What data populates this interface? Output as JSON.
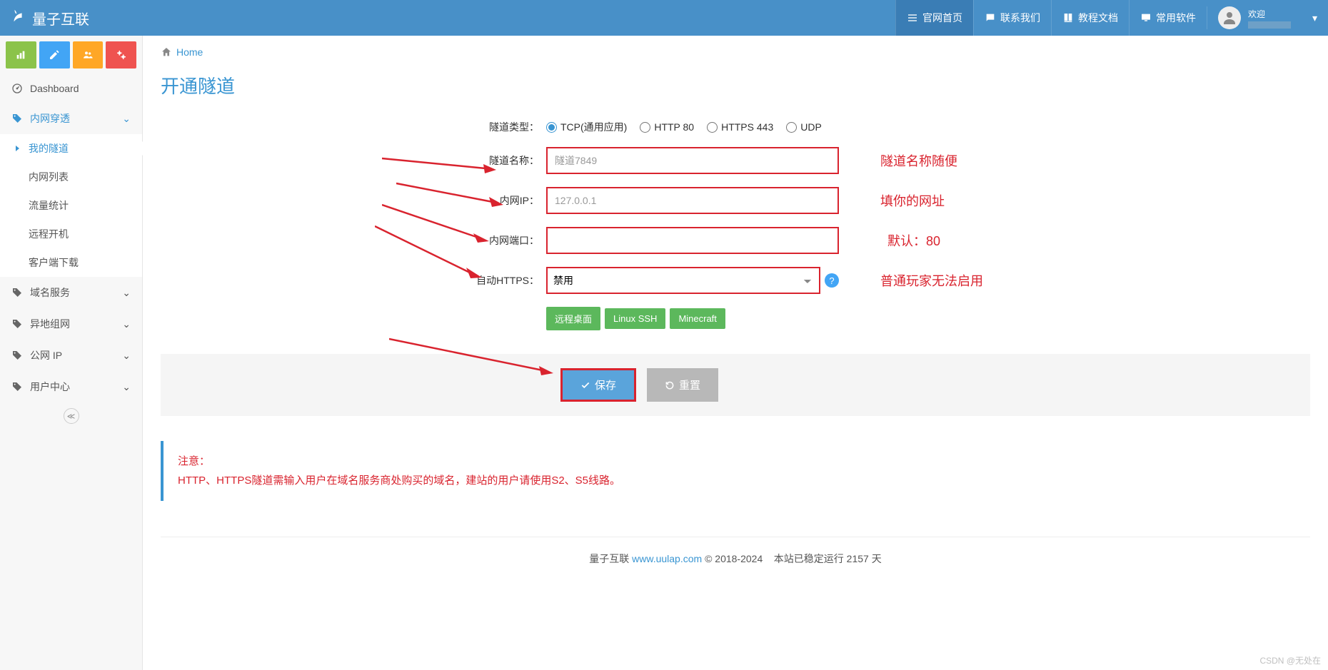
{
  "brand": "量子互联",
  "topnav": {
    "items": [
      {
        "label": "官网首页",
        "icon": "home"
      },
      {
        "label": "联系我们",
        "icon": "chat"
      },
      {
        "label": "教程文档",
        "icon": "book"
      },
      {
        "label": "常用软件",
        "icon": "desktop"
      }
    ],
    "welcome": "欢迎"
  },
  "breadcrumb": {
    "home": "Home"
  },
  "page_title": "开通隧道",
  "sidebar": {
    "dashboard": "Dashboard",
    "nat": "内网穿透",
    "nat_items": [
      "我的隧道",
      "内网列表",
      "流量统计",
      "远程开机",
      "客户端下载"
    ],
    "domain": "域名服务",
    "remote_net": "异地组网",
    "public_ip": "公网 IP",
    "user_center": "用户中心"
  },
  "form": {
    "tunnel_type_label": "隧道类型：",
    "tunnel_type_options": [
      "TCP(通用应用)",
      "HTTP 80",
      "HTTPS 443",
      "UDP"
    ],
    "tunnel_name_label": "隧道名称：",
    "tunnel_name_placeholder": "隧道7849",
    "intranet_ip_label": "内网IP：",
    "intranet_ip_placeholder": "127.0.0.1",
    "intranet_port_label": "内网端口：",
    "auto_https_label": "自动HTTPS：",
    "auto_https_value": "禁用",
    "presets": [
      "远程桌面",
      "Linux SSH",
      "Minecraft"
    ],
    "save": "保存",
    "reset": "重置"
  },
  "annotations": {
    "tunnel_name": "隧道名称随便",
    "intranet_ip": "填你的网址",
    "intranet_port": "默认：80",
    "auto_https": "普通玩家无法启用"
  },
  "notice": {
    "title": "注意：",
    "body": "HTTP、HTTPS隧道需输入用户在域名服务商处购买的域名，建站的用户请使用S2、S5线路。"
  },
  "footer": {
    "brand": "量子互联",
    "url": "www.uulap.com",
    "copyright": "© 2018-2024",
    "uptime": "本站已稳定运行 2157 天"
  },
  "watermark": "CSDN @无处在"
}
